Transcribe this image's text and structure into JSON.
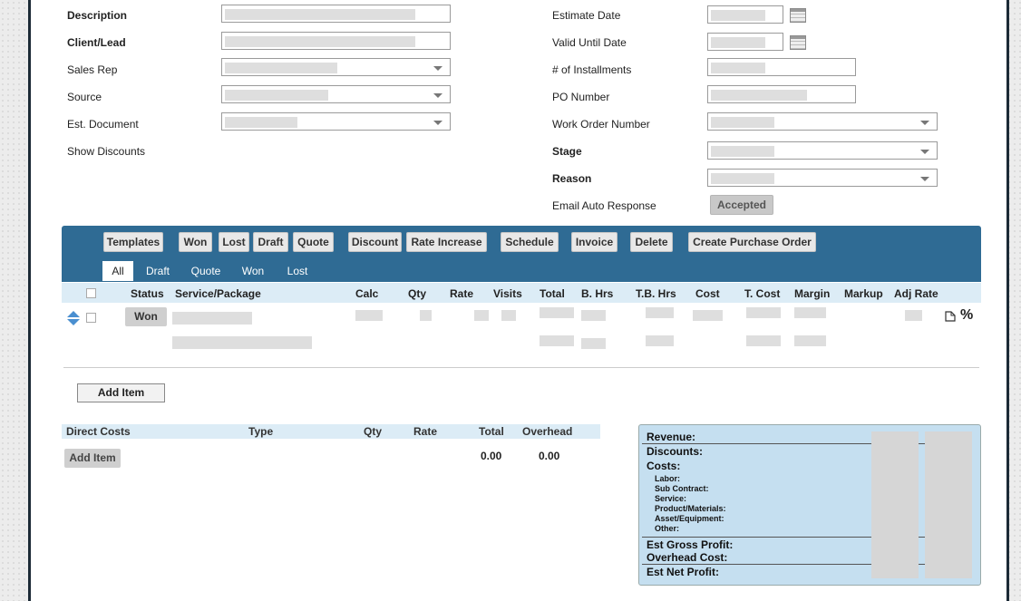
{
  "form": {
    "left": {
      "description_label": "Description",
      "client_label": "Client/Lead",
      "sales_rep_label": "Sales Rep",
      "source_label": "Source",
      "est_document_label": "Est. Document",
      "show_discounts_label": "Show Discounts"
    },
    "right": {
      "estimate_date_label": "Estimate Date",
      "valid_until_label": "Valid Until Date",
      "installments_label": "# of Installments",
      "po_number_label": "PO Number",
      "work_order_label": "Work Order Number",
      "stage_label": "Stage",
      "reason_label": "Reason",
      "email_auto_label": "Email Auto Response",
      "email_auto_button": "Accepted"
    }
  },
  "toolbar": {
    "buttons": [
      "Templates",
      "Won",
      "Lost",
      "Draft",
      "Quote",
      "Discount",
      "Rate Increase",
      "Schedule",
      "Invoice",
      "Delete",
      "Create Purchase Order"
    ],
    "filters": [
      "All",
      "Draft",
      "Quote",
      "Won",
      "Lost"
    ],
    "active_filter": "All"
  },
  "table": {
    "headers": [
      "Status",
      "Service/Package",
      "Calc",
      "Qty",
      "Rate",
      "Visits",
      "Total",
      "B. Hrs",
      "T.B. Hrs",
      "Cost",
      "T. Cost",
      "Margin",
      "Markup",
      "Adj Rate"
    ],
    "row_status": "Won",
    "percent_symbol": "%"
  },
  "add_item_label": "Add Item",
  "direct_costs": {
    "headers": [
      "Direct Costs",
      "Type",
      "Qty",
      "Rate",
      "Total",
      "Overhead"
    ],
    "add_item_label": "Add Item",
    "total": "0.00",
    "overhead": "0.00"
  },
  "summary": {
    "revenue": "Revenue:",
    "discounts": "Discounts:",
    "costs": "Costs:",
    "labor": "Labor:",
    "sub_contract": "Sub Contract:",
    "service": "Service:",
    "product": "Product/Materials:",
    "asset": "Asset/Equipment:",
    "other": "Other:",
    "gross_profit": "Est Gross Profit:",
    "overhead_cost": "Overhead Cost:",
    "net_profit": "Est Net Profit:"
  },
  "colors": {
    "toolbar": "#2f6b94",
    "summary_bg": "#c5dff0",
    "header_bg": "#dcecf6"
  }
}
